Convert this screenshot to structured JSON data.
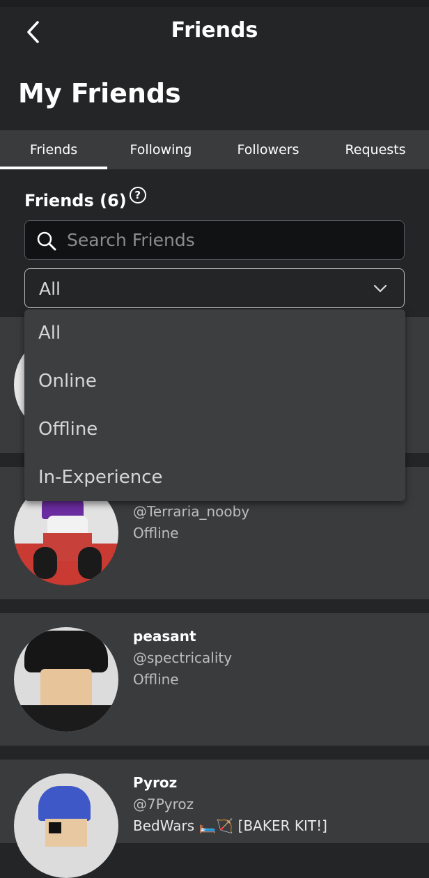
{
  "header": {
    "title": "Friends",
    "back_icon": "chevron-left-icon"
  },
  "page_title": "My Friends",
  "tabs": [
    {
      "label": "Friends",
      "active": true
    },
    {
      "label": "Following"
    },
    {
      "label": "Followers"
    },
    {
      "label": "Requests"
    }
  ],
  "friends_count_label": "Friends (6)",
  "help_icon": "?",
  "search": {
    "placeholder": "Search Friends",
    "value": ""
  },
  "filter": {
    "selected": "All",
    "options": [
      "All",
      "Online",
      "Offline",
      "In-Experience"
    ]
  },
  "friends": [
    {
      "name": "",
      "username": "",
      "status": ""
    },
    {
      "name": "",
      "username": "@Terraria_nooby",
      "status": "Offline"
    },
    {
      "name": "peasant",
      "username": "@spectricality",
      "status": "Offline"
    },
    {
      "name": "Pyroz",
      "username": "@7Pyroz",
      "status": "BedWars 🛏️🏹 [BAKER KIT!]"
    }
  ],
  "colors": {
    "background": "#232527",
    "card": "#393b3d",
    "menu": "#3c3e40"
  }
}
